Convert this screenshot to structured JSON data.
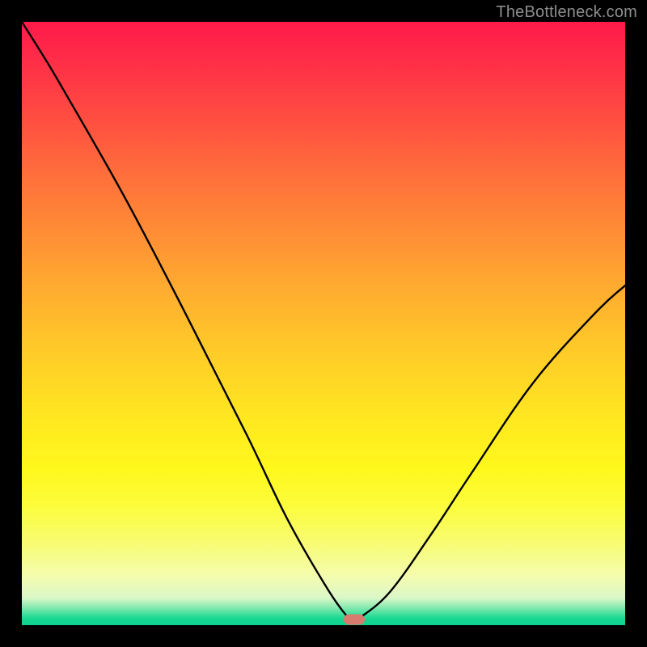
{
  "watermark": "TheBottleneck.com",
  "marker": {
    "x_frac": 0.5506,
    "y_frac": 0.9905,
    "color": "#d87a6e"
  },
  "chart_data": {
    "type": "line",
    "title": "",
    "xlabel": "",
    "ylabel": "",
    "xlim": [
      0,
      100
    ],
    "ylim": [
      0,
      100
    ],
    "grid": false,
    "legend": false,
    "background_gradient": [
      {
        "pos": 0,
        "color": "#ff1a4a"
      },
      {
        "pos": 15,
        "color": "#ff4a42"
      },
      {
        "pos": 34,
        "color": "#ff8a36"
      },
      {
        "pos": 55,
        "color": "#ffcc28"
      },
      {
        "pos": 74,
        "color": "#fff81c"
      },
      {
        "pos": 92,
        "color": "#f4fcb0"
      },
      {
        "pos": 97,
        "color": "#8beab0"
      },
      {
        "pos": 100,
        "color": "#0fd38d"
      }
    ],
    "series": [
      {
        "name": "bottleneck-curve",
        "stroke": "#000000",
        "x": [
          0.0,
          3.4,
          6.8,
          17.0,
          27.1,
          37.3,
          44.1,
          50.8,
          54.2,
          55.1,
          55.9,
          61.0,
          67.8,
          74.6,
          84.7,
          94.9,
          100.0
        ],
        "values": [
          100.0,
          94.6,
          88.9,
          71.0,
          51.7,
          31.5,
          17.4,
          5.8,
          1.1,
          0.5,
          1.1,
          5.5,
          15.0,
          25.3,
          40.1,
          51.6,
          56.3
        ]
      }
    ],
    "markers": [
      {
        "name": "bottleneck-marker",
        "x": 55.1,
        "y": 0.95,
        "shape": "pill",
        "color": "#d87a6e"
      }
    ]
  }
}
